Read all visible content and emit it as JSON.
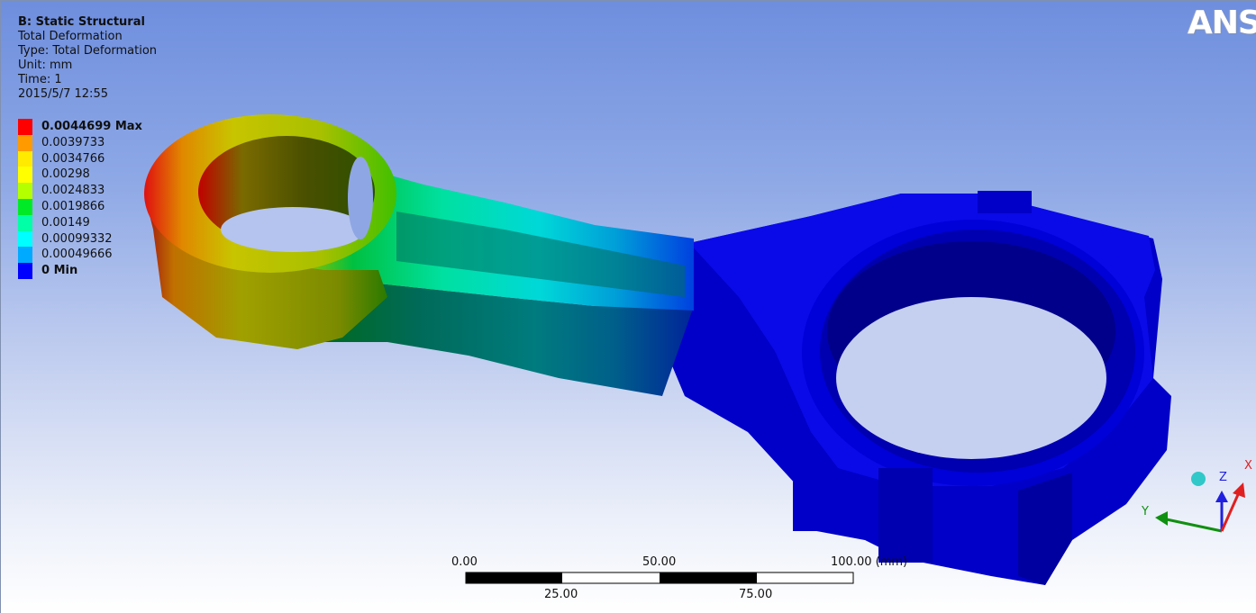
{
  "info": {
    "title": "B: Static Structural",
    "result_name": "Total Deformation",
    "type": "Type: Total Deformation",
    "unit": "Unit: mm",
    "time": "Time: 1",
    "date": "2015/5/7 12:55"
  },
  "legend": {
    "items": [
      {
        "label": "0.0044699 Max",
        "color": "#ff0000",
        "bold": true
      },
      {
        "label": "0.0039733",
        "color": "#ff9a00"
      },
      {
        "label": "0.0034766",
        "color": "#ffea00"
      },
      {
        "label": "0.00298",
        "color": "#ffff00"
      },
      {
        "label": "0.0024833",
        "color": "#b4ff00"
      },
      {
        "label": "0.0019866",
        "color": "#00ea28"
      },
      {
        "label": "0.00149",
        "color": "#00ffa6"
      },
      {
        "label": "0.00099332",
        "color": "#00ffff"
      },
      {
        "label": "0.00049666",
        "color": "#00aaff"
      },
      {
        "label": "0 Min",
        "color": "#0000ff",
        "bold": true
      }
    ]
  },
  "scale_bar": {
    "top_labels": [
      "0.00",
      "50.00",
      "100.00 (mm)"
    ],
    "bottom_labels": [
      "25.00",
      "75.00"
    ]
  },
  "triad": {
    "x_label": "X",
    "y_label": "Y",
    "z_label": "Z"
  },
  "logo_text": "ANS",
  "colors": {
    "background_top": "#6e8ede",
    "background_bottom": "#ffffff",
    "min_blue": "#0000ff",
    "max_red": "#ff0000"
  }
}
